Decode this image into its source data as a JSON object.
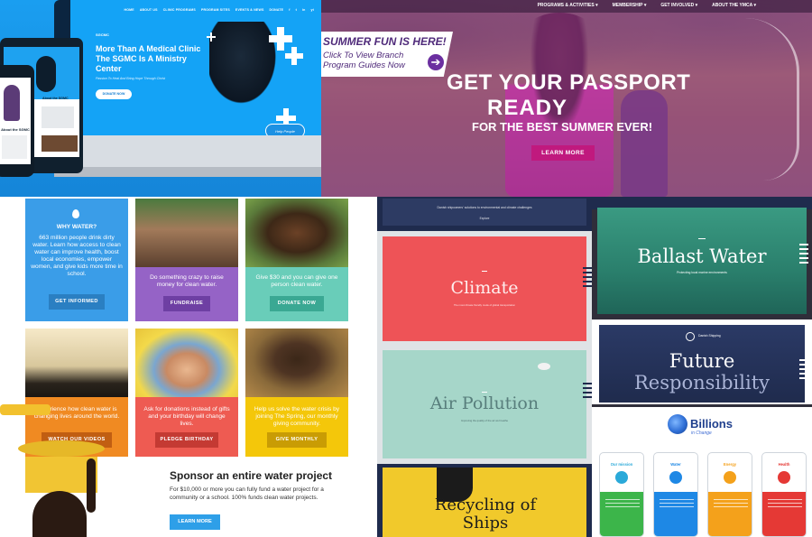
{
  "sgmc": {
    "nav": [
      "HOME",
      "ABOUT US",
      "CLINIC PROGRAMS",
      "PROGRAM SITES",
      "EVENTS & NEWS",
      "DONATE",
      "f",
      "t",
      "in",
      "yt"
    ],
    "logo": "SGCMC",
    "headline": "More Than A Medical Clinic The SGMC Is A Ministry Center",
    "tagline": "Passion To Heal And Bring Hope Through Christ",
    "donate_label": "DONATE NOW",
    "help_badge": "Help People",
    "about_label": "About the SGMC",
    "about_tablet": "About the SGMC"
  },
  "ymca": {
    "nav": [
      "PROGRAMS & ACTIVITIES ▾",
      "MEMBERSHIP ▾",
      "GET INVOLVED ▾",
      "ABOUT THE YMCA ▾"
    ],
    "promo_title": "SUMMER FUN IS HERE!",
    "promo_text": "Click To View Branch Program Guides Now",
    "promo_arrow": "➔",
    "headline_1": "GET YOUR PASSPORT",
    "headline_2": "READY",
    "headline_3": "FOR THE BEST SUMMER EVER!",
    "cta": "LEARN MORE"
  },
  "charity": {
    "tiles": [
      {
        "text": "663 million people drink dirty water. Learn how access to clean water can improve health, boost local economies, empower women, and give kids more time in school.",
        "heading": "WHY WATER?",
        "button": "GET INFORMED",
        "color": "#3a9de8",
        "btn_color": "#2a7fc2"
      },
      {
        "text": "Do something crazy to raise money for clean water.",
        "button": "FUNDRAISE",
        "color": "#9563c6",
        "btn_color": "#6e3fa3"
      },
      {
        "text": "Give $30 and you can give one person clean water.",
        "button": "DONATE NOW",
        "color": "#69cdb9",
        "btn_color": "#3aa893"
      },
      {
        "text": "Experience how clean water is changing lives around the world.",
        "button": "WATCH OUR VIDEOS",
        "color": "#f08a22",
        "btn_color": "#c15e12"
      },
      {
        "text": "Ask for donations instead of gifts and your birthday will change lives.",
        "button": "PLEDGE BIRTHDAY",
        "color": "#ee5b52",
        "btn_color": "#c43a33"
      },
      {
        "text": "Help us solve the water crisis by joining The Spring, our monthly giving community.",
        "button": "GIVE MONTHLY",
        "color": "#f4c70a",
        "btn_color": "#c99c04"
      }
    ],
    "sponsor_title": "Sponsor an entire water project",
    "sponsor_text": "For $10,000 or more you can fully fund a water project for a community or a school. 100% funds clean water projects.",
    "sponsor_button": "LEARN MORE"
  },
  "shipping": {
    "intro": "Danish shipowners' solutions to environmental and climate challenges",
    "intro_sub": "Explore",
    "climate_title": "Climate",
    "climate_sub": "The most climate friendly mode of global transportation",
    "air_title": "Air Pollution",
    "air_sub": "Improving the quality of the air we breathe",
    "recycle_title": "Recycling of Ships",
    "ballast_title": "Ballast Water",
    "ballast_sub": "Protecting local marine environments",
    "future_title_1": "Future",
    "future_title_2": "Responsibility",
    "future_logo": "Danish Shipping"
  },
  "billions": {
    "title": "Billions",
    "subtitle": "in Change",
    "cards": [
      {
        "label": "Our mission",
        "color": "#2aa9d9",
        "body": "#3cb54a"
      },
      {
        "label": "Water",
        "color": "#1e88e5",
        "body": "#1e88e5"
      },
      {
        "label": "Energy",
        "color": "#f4a11b",
        "body": "#f4a11b"
      },
      {
        "label": "Health",
        "color": "#e53935",
        "body": "#e53935"
      }
    ]
  }
}
